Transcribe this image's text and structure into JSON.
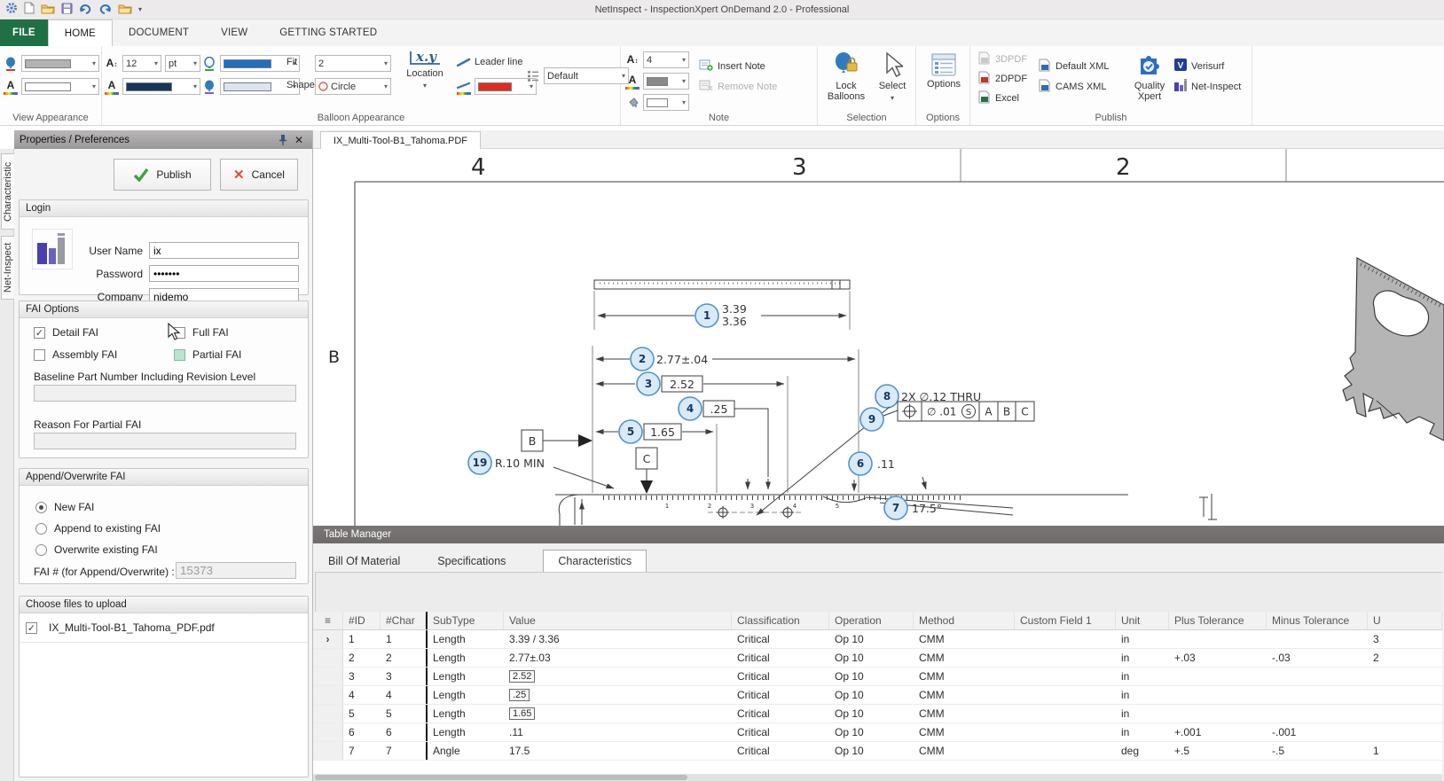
{
  "window": {
    "title": "NetInspect - InspectionXpert OnDemand 2.0 - Professional"
  },
  "menu_tabs": [
    {
      "label": "FILE",
      "file": true
    },
    {
      "label": "HOME",
      "active": true
    },
    {
      "label": "DOCUMENT"
    },
    {
      "label": "VIEW"
    },
    {
      "label": "GETTING STARTED"
    }
  ],
  "ribbon": {
    "groups": {
      "view_appearance": "View Appearance",
      "balloon_appearance": "Balloon Appearance",
      "note": "Note",
      "selection": "Selection",
      "options": "Options",
      "publish": "Publish"
    },
    "font_size_value": "12",
    "font_unit_value": "pt",
    "fit_label": "Fit",
    "fit_value": "2",
    "shape_label": "Shape",
    "shape_value": "Circle",
    "location_xy": "x.y",
    "location_label": "Location",
    "leader_line_label": "Leader line",
    "style_value": "Default",
    "note_font_size_value": "4",
    "insert_note_label": "Insert Note",
    "remove_note_label": "Remove Note",
    "lock_balloons_label": "Lock Balloons",
    "select_label": "Select",
    "options_button_label": "Options",
    "publish_buttons": {
      "pdf3d": "3DPDF",
      "pdf2d": "2DPDF",
      "excel": "Excel",
      "default_xml": "Default XML",
      "cams_xml": "CAMS XML",
      "quality_xpert": "Quality Xpert",
      "verisurf": "Verisurf",
      "net_inspect": "Net-Inspect"
    },
    "swatches": {
      "view_balloon": "#b3b3b3",
      "view_text": "#ffffff",
      "balloon_font_color": "#16365c",
      "balloon_border_color": "#1f6fc4",
      "balloon_fill_color": "#dbe5f1",
      "leader_color": "#e02b20",
      "note_font_color": "#8a8a8a",
      "note_fill_color": "#ffffff"
    }
  },
  "side_tabs": [
    {
      "label": "Characteristic"
    },
    {
      "label": "Net-Inspect"
    }
  ],
  "panel": {
    "title": "Properties / Preferences",
    "publish_button": "Publish",
    "cancel_button": "Cancel",
    "login": {
      "title": "Login",
      "user_label": "User Name",
      "user_value": "ix",
      "password_label": "Password",
      "password_value": "•••••••",
      "company_label": "Company",
      "company_value": "nidemo"
    },
    "fai": {
      "title": "FAI Options",
      "detail": "Detail FAI",
      "full": "Full FAI",
      "assembly": "Assembly FAI",
      "partial": "Partial FAI",
      "baseline_label": "Baseline Part Number Including Revision Level",
      "baseline_value": "",
      "reason_label": "Reason For Partial FAI",
      "reason_value": ""
    },
    "append": {
      "title": "Append/Overwrite FAI",
      "new_fai": "New FAI",
      "append_existing": "Append to existing FAI",
      "overwrite_existing": "Overwrite existing FAI",
      "fai_number_label": "FAI # (for Append/Overwrite) :",
      "fai_number_value": "15373"
    },
    "files": {
      "title": "Choose files to upload",
      "items": [
        {
          "name": "IX_Multi-Tool-B1_Tahoma_PDF.pdf",
          "checked": true
        }
      ]
    }
  },
  "document": {
    "tab_label": "IX_Multi-Tool-B1_Tahoma.PDF"
  },
  "drawing": {
    "zones": [
      "4",
      "3",
      "2"
    ],
    "row_label": "B",
    "ruler_numbers": [
      "1",
      "2",
      "3",
      "4",
      "5"
    ],
    "balloons": {
      "b1": "1",
      "b2": "2",
      "b3": "3",
      "b4": "4",
      "b5": "5",
      "b6": "6",
      "b7": "7",
      "b8": "8",
      "b9": "9",
      "b19": "19"
    },
    "dims": {
      "d1_upper": "3.39",
      "d1_lower": "3.36",
      "d2": "2.77±.04",
      "d3": "2.52",
      "d4": ".25",
      "d5": "1.65",
      "d6": ".11",
      "d7": "17.5°",
      "d8": "2X ∅.12 THRU",
      "d19": "R.10 MIN"
    },
    "fcf": {
      "tolerance": "∅ .01",
      "modifier": "S",
      "datum_a": "A",
      "datum_b": "B",
      "datum_c": "C"
    },
    "datums": {
      "b": "B",
      "c": "C"
    }
  },
  "table_manager": {
    "title": "Table Manager",
    "menu_icon": "≡",
    "row_marker": "›",
    "tabs": [
      {
        "label": "Bill Of Material"
      },
      {
        "label": "Specifications"
      },
      {
        "label": "Characteristics",
        "active": true
      }
    ],
    "columns": [
      "#ID",
      "#Char",
      "SubType",
      "Value",
      "Classification",
      "Operation",
      "Method",
      "Custom Field 1",
      "Unit",
      "Plus Tolerance",
      "Minus Tolerance",
      "U"
    ],
    "rows": [
      {
        "id": "1",
        "char": "1",
        "subtype": "Length",
        "value": "3.39 / 3.36",
        "classification": "Critical",
        "operation": "Op 10",
        "method": "CMM",
        "custom1": "",
        "unit": "in",
        "plus": "",
        "minus": "",
        "last": "3",
        "selected": true
      },
      {
        "id": "2",
        "char": "2",
        "subtype": "Length",
        "value": "2.77±.03",
        "classification": "Critical",
        "operation": "Op 10",
        "method": "CMM",
        "custom1": "",
        "unit": "in",
        "plus": "+.03",
        "minus": "-.03",
        "last": "2"
      },
      {
        "id": "3",
        "char": "3",
        "subtype": "Length",
        "value": "2.52",
        "boxed": true,
        "classification": "Critical",
        "operation": "Op 10",
        "method": "CMM",
        "custom1": "",
        "unit": "in",
        "plus": "",
        "minus": "",
        "last": ""
      },
      {
        "id": "4",
        "char": "4",
        "subtype": "Length",
        "value": ".25",
        "boxed": true,
        "classification": "Critical",
        "operation": "Op 10",
        "method": "CMM",
        "custom1": "",
        "unit": "in",
        "plus": "",
        "minus": "",
        "last": ""
      },
      {
        "id": "5",
        "char": "5",
        "subtype": "Length",
        "value": "1.65",
        "boxed": true,
        "classification": "Critical",
        "operation": "Op 10",
        "method": "CMM",
        "custom1": "",
        "unit": "in",
        "plus": "",
        "minus": "",
        "last": ""
      },
      {
        "id": "6",
        "char": "6",
        "subtype": "Length",
        "value": ".11",
        "classification": "Critical",
        "operation": "Op 10",
        "method": "CMM",
        "custom1": "",
        "unit": "in",
        "plus": "+.001",
        "minus": "-.001",
        "last": ""
      },
      {
        "id": "7",
        "char": "7",
        "subtype": "Angle",
        "value": "17.5",
        "classification": "Critical",
        "operation": "Op 10",
        "method": "CMM",
        "custom1": "",
        "unit": "deg",
        "plus": "+.5",
        "minus": "-.5",
        "last": "1"
      }
    ]
  }
}
